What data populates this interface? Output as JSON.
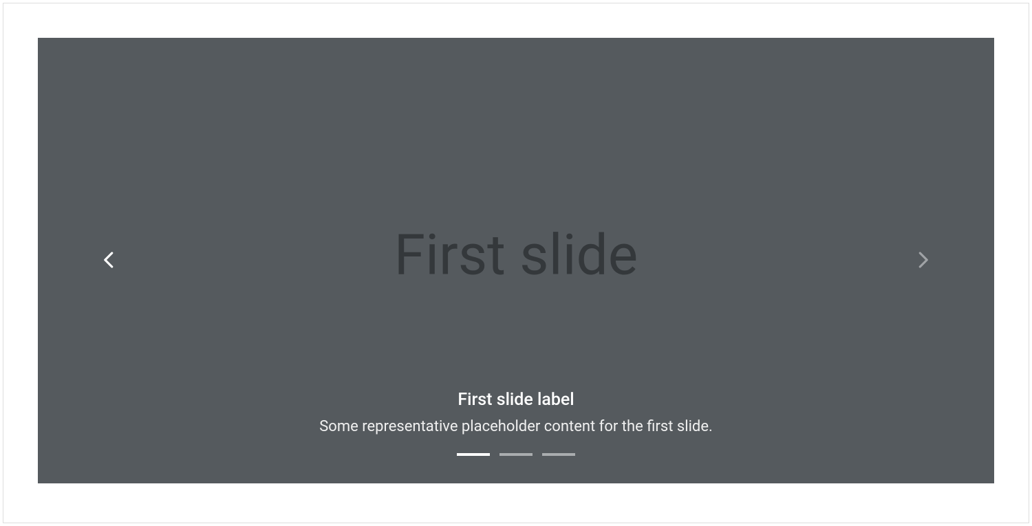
{
  "carousel": {
    "slide_image_text": "First slide",
    "caption": {
      "title": "First slide label",
      "description": "Some representative placeholder content for the first slide."
    },
    "controls": {
      "prev_label": "Previous",
      "next_label": "Next"
    },
    "indicators": [
      {
        "active": true
      },
      {
        "active": false
      },
      {
        "active": false
      }
    ],
    "colors": {
      "slide_background": "#555a5e",
      "slide_text": "#34383b",
      "caption_text": "#ffffff"
    }
  }
}
